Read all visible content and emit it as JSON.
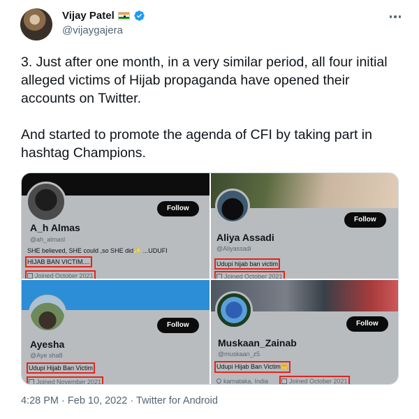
{
  "author": {
    "display_name": "Vijay Patel",
    "handle": "@vijaygajera",
    "flag_icon": "india-flag-icon",
    "verified_icon": "verified-badge-icon",
    "verified_color": "#1d9bf0"
  },
  "tweet": {
    "paragraph_1": "3. Just after one month, in a very similar period, all four initial alleged victims of Hijab propaganda have opened their accounts on Twitter.",
    "paragraph_2": "And started to promote the agenda of CFI by taking part in hashtag Champions."
  },
  "media": {
    "highlight_color": "#e3241b",
    "panels": [
      {
        "name": "A_h Almas",
        "handle": "@ah_almasl",
        "bio_line_1": "SHE believed, SHE could ,so SHE did✨ ...UDUFI",
        "bio_line_2": "HIJAB BAN VICTIM....",
        "meta": "Joined October 2021",
        "follow_label": "Follow"
      },
      {
        "name": "Aliya Assadi",
        "handle": "@Aliyassadi",
        "bio_line_1": "Udupi hijab ban victim",
        "meta": "Joined October 2021",
        "follow_label": "Follow"
      },
      {
        "name": "Ayesha",
        "handle": "@Aye sha8",
        "bio_line_1": "Udupi Hijab Ban Victim",
        "meta": "Joined November 2021",
        "follow_label": "Follow"
      },
      {
        "name": "Muskaan_Zainab",
        "handle": "@muskaan_z5",
        "bio_line_1": "Udupi Hijab Ban Victim🤲",
        "location": "karnataka, India",
        "meta": "Joined October 2021",
        "follow_label": "Follow"
      }
    ]
  },
  "footer": {
    "time": "4:28 PM",
    "separator": "·",
    "date": "Feb 10, 2022",
    "client": "Twitter for Android"
  }
}
